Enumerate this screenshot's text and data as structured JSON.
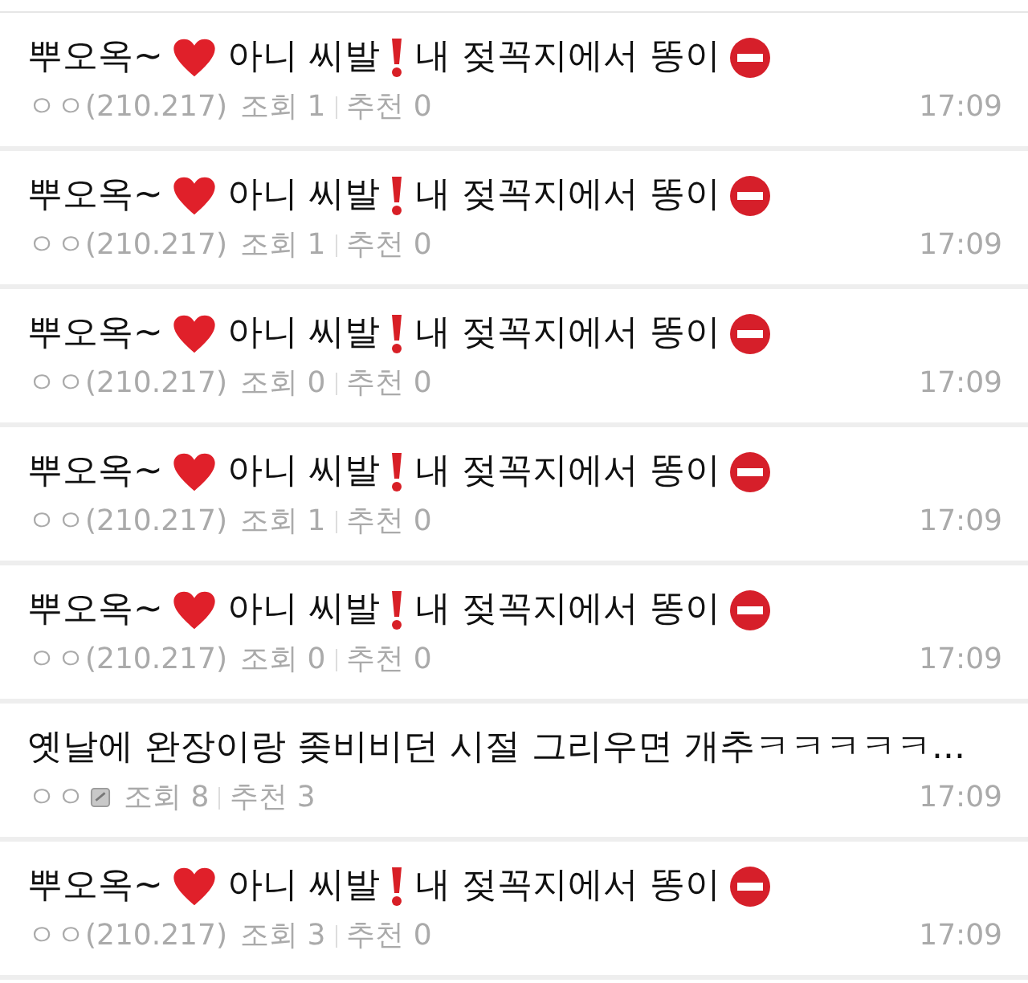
{
  "posts": [
    {
      "kind": "emoji",
      "title_parts": [
        "뿌오옥~",
        "아니 씨발",
        "내 젖꼭지에서 똥이"
      ],
      "author": "ㅇㅇ(210.217)",
      "member": false,
      "views": "조회 1",
      "likes": "추천 0",
      "time": "17:09"
    },
    {
      "kind": "emoji",
      "title_parts": [
        "뿌오옥~",
        "아니 씨발",
        "내 젖꼭지에서 똥이"
      ],
      "author": "ㅇㅇ(210.217)",
      "member": false,
      "views": "조회 1",
      "likes": "추천 0",
      "time": "17:09"
    },
    {
      "kind": "emoji",
      "title_parts": [
        "뿌오옥~",
        "아니 씨발",
        "내 젖꼭지에서 똥이"
      ],
      "author": "ㅇㅇ(210.217)",
      "member": false,
      "views": "조회 0",
      "likes": "추천 0",
      "time": "17:09"
    },
    {
      "kind": "emoji",
      "title_parts": [
        "뿌오옥~",
        "아니 씨발",
        "내 젖꼭지에서 똥이"
      ],
      "author": "ㅇㅇ(210.217)",
      "member": false,
      "views": "조회 1",
      "likes": "추천 0",
      "time": "17:09"
    },
    {
      "kind": "emoji",
      "title_parts": [
        "뿌오옥~",
        "아니 씨발",
        "내 젖꼭지에서 똥이"
      ],
      "author": "ㅇㅇ(210.217)",
      "member": false,
      "views": "조회 0",
      "likes": "추천 0",
      "time": "17:09"
    },
    {
      "kind": "plain",
      "title_parts": [
        "옛날에 완장이랑 좆비비던 시절 그리우면 개추ㅋㅋㅋㅋㅋ..."
      ],
      "author": "ㅇㅇ",
      "member": true,
      "views": "조회 8",
      "likes": "추천 3",
      "time": "17:09"
    },
    {
      "kind": "emoji",
      "title_parts": [
        "뿌오옥~",
        "아니 씨발",
        "내 젖꼭지에서 똥이"
      ],
      "author": "ㅇㅇ(210.217)",
      "member": false,
      "views": "조회 3",
      "likes": "추천 0",
      "time": "17:09"
    }
  ]
}
